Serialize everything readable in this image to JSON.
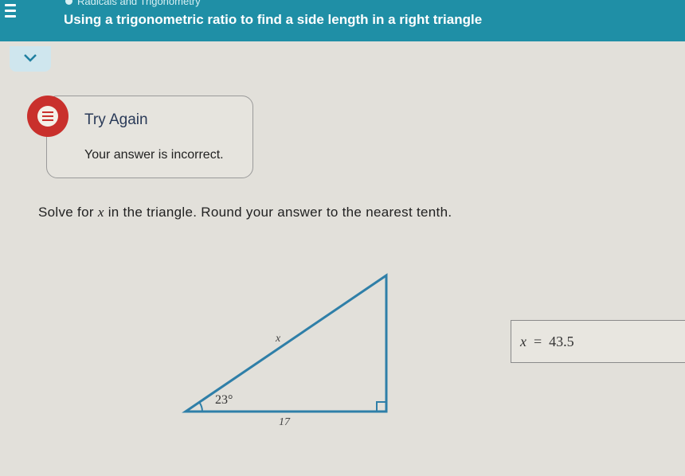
{
  "header": {
    "breadcrumb": "Radicals and Trigonometry",
    "title": "Using a trigonometric ratio to find a side length in a right triangle"
  },
  "feedback": {
    "title": "Try Again",
    "message": "Your answer is incorrect."
  },
  "question": {
    "prefix": "Solve for ",
    "variable": "x",
    "suffix": " in the triangle. Round your answer to the nearest tenth."
  },
  "triangle": {
    "angle_label": "23°",
    "hypotenuse_label": "x",
    "base_label": "17"
  },
  "answer": {
    "variable": "x",
    "equals": "=",
    "value": "43.5"
  },
  "colors": {
    "header": "#1f8fa6",
    "error": "#c9302c",
    "triangle_stroke": "#2f7fa8"
  },
  "icons": {
    "menu": "hamburger-icon",
    "collapse": "chevron-down-icon",
    "feedback": "feedback-error-icon"
  }
}
